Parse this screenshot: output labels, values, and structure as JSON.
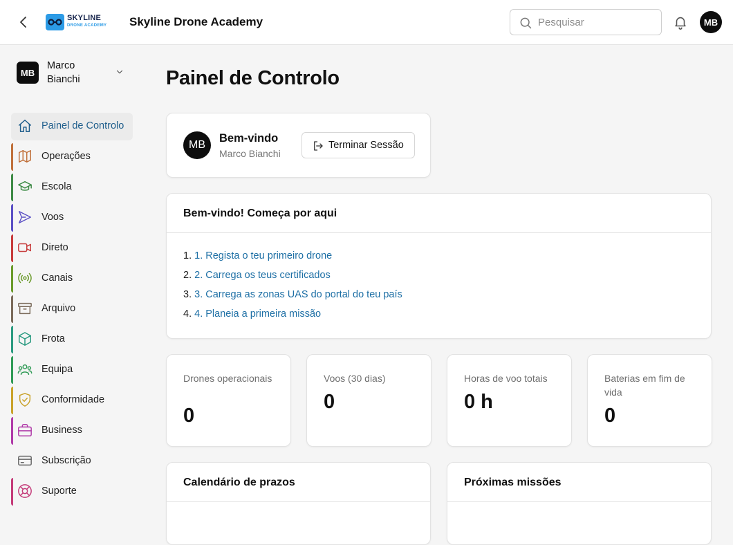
{
  "header": {
    "logo_line1": "SKYLINE",
    "logo_line2": "DRONE ACADEMY",
    "app_title": "Skyline Drone Academy",
    "search_placeholder": "Pesquisar",
    "avatar_initials": "MB"
  },
  "sidebar": {
    "user": {
      "initials": "MB",
      "name": "Marco Bianchi"
    },
    "items": [
      {
        "label": "Painel de Controlo",
        "icon": "home-icon",
        "color": "#1f5e8c",
        "active": true
      },
      {
        "label": "Operações",
        "icon": "map-icon",
        "color": "#c0703a"
      },
      {
        "label": "Escola",
        "icon": "graduation-cap-icon",
        "color": "#3d8a45"
      },
      {
        "label": "Voos",
        "icon": "send-icon",
        "color": "#5a4fc4"
      },
      {
        "label": "Direto",
        "icon": "video-icon",
        "color": "#c73b3b"
      },
      {
        "label": "Canais",
        "icon": "radio-icon",
        "color": "#6a9a2a"
      },
      {
        "label": "Arquivo",
        "icon": "archive-icon",
        "color": "#7a6a5a"
      },
      {
        "label": "Frota",
        "icon": "box-icon",
        "color": "#2a9a80"
      },
      {
        "label": "Equipa",
        "icon": "users-icon",
        "color": "#2f9a55"
      },
      {
        "label": "Conformidade",
        "icon": "shield-check-icon",
        "color": "#c9a22a"
      },
      {
        "label": "Business",
        "icon": "briefcase-icon",
        "color": "#b03aa8"
      },
      {
        "label": "Subscrição",
        "icon": "credit-card-icon",
        "color": ""
      },
      {
        "label": "Suporte",
        "icon": "life-buoy-icon",
        "color": "#c43a78"
      }
    ]
  },
  "main": {
    "page_title": "Painel de Controlo",
    "welcome": {
      "initials": "MB",
      "greeting": "Bem-vindo",
      "name": "Marco Bianchi",
      "logout_label": "Terminar Sessão"
    },
    "getting_started": {
      "title": "Bem-vindo! Começa por aqui",
      "steps": [
        {
          "num": "1.",
          "text": "1. Regista o teu primeiro drone"
        },
        {
          "num": "2.",
          "text": "2. Carrega os teus certificados"
        },
        {
          "num": "3.",
          "text": "3. Carrega as zonas UAS do portal do teu país"
        },
        {
          "num": "4.",
          "text": "4. Planeia a primeira missão"
        }
      ]
    },
    "stats": [
      {
        "label": "Drones operacionais",
        "value": "0"
      },
      {
        "label": "Voos (30 dias)",
        "value": "0"
      },
      {
        "label": "Horas de voo totais",
        "value": "0 h"
      },
      {
        "label": "Baterias em fim de vida",
        "value": "0"
      }
    ],
    "calendar_title": "Calendário de prazos",
    "missions_title": "Próximas missões"
  }
}
